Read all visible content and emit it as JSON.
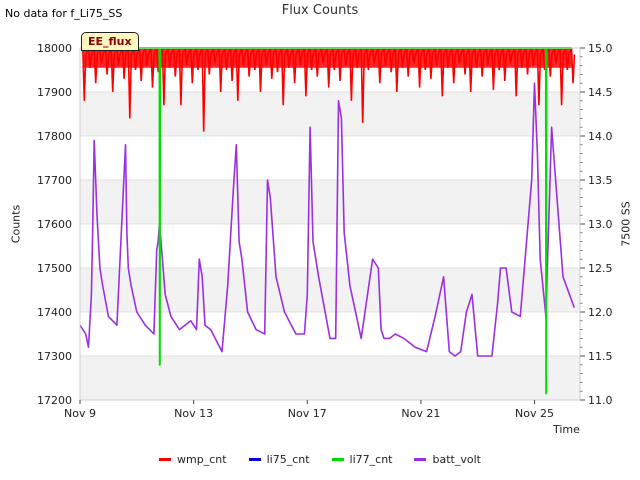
{
  "header": {
    "nodata_text": "No data for f_Li75_SS",
    "title": "Flux Counts",
    "badge": "EE_flux"
  },
  "axes": {
    "ylabel": "Counts",
    "y2label": "7500 SS",
    "xlabel": "Time"
  },
  "colors": {
    "wmp_cnt": "#ff0000",
    "li75_cnt": "#0000cc",
    "li77_cnt": "#00dd00",
    "batt_volt": "#9b30e0"
  },
  "legend": [
    {
      "label": "wmp_cnt",
      "color": "#ff0000"
    },
    {
      "label": "li75_cnt",
      "color": "#0000cc"
    },
    {
      "label": "li77_cnt",
      "color": "#00dd00"
    },
    {
      "label": "batt_volt",
      "color": "#9b30e0"
    }
  ],
  "chart_data": {
    "type": "line",
    "title": "Flux Counts",
    "xlabel": "Time",
    "ylabel": "Counts",
    "y2label": "7500 SS",
    "x_ticks": [
      "Nov 9",
      "Nov 13",
      "Nov 17",
      "Nov 21",
      "Nov 25"
    ],
    "x_tick_days": [
      9,
      13,
      17,
      21,
      25
    ],
    "xlim_days": [
      9,
      26.6
    ],
    "ylim": [
      17200,
      18000
    ],
    "y_ticks": [
      17200,
      17300,
      17400,
      17500,
      17600,
      17700,
      17800,
      17900,
      18000
    ],
    "y2lim": [
      11.0,
      15.0
    ],
    "y2_ticks": [
      11.0,
      11.5,
      12.0,
      12.5,
      13.0,
      13.5,
      14.0,
      14.5,
      15.0
    ],
    "grid": true,
    "legend_position": "bottom",
    "series": [
      {
        "name": "wmp_cnt",
        "axis": "left",
        "x_days": [
          9.1,
          9.3,
          9.5,
          9.7,
          9.9,
          10.1,
          10.3,
          10.5,
          10.7,
          10.9,
          11.1,
          11.3,
          11.5,
          11.7,
          11.9,
          12.1,
          12.3,
          12.5,
          12.7,
          12.9,
          13.1,
          13.3,
          13.5,
          13.7,
          13.9,
          14.1,
          14.3,
          14.5,
          14.7,
          14.9,
          15.1,
          15.3,
          15.5,
          15.7,
          15.9,
          16.1,
          16.3,
          16.5,
          16.7,
          16.9,
          17.1,
          17.3,
          17.5,
          17.7,
          17.9,
          18.1,
          18.3,
          18.5,
          18.7,
          18.9,
          19.1,
          19.3,
          19.5,
          19.7,
          19.9,
          20.1,
          20.3,
          20.5,
          20.7,
          20.9,
          21.1,
          21.3,
          21.5,
          21.7,
          21.9,
          22.1,
          22.3,
          22.5,
          22.7,
          22.9,
          23.1,
          23.3,
          23.5,
          23.7,
          23.9,
          24.1,
          24.3,
          24.5,
          24.7,
          24.9,
          25.1,
          25.3,
          25.5,
          25.7,
          25.9,
          26.1,
          26.3
        ],
        "values": [
          17880,
          17955,
          17920,
          17965,
          17940,
          17900,
          17960,
          17930,
          17840,
          17950,
          17925,
          17960,
          17910,
          17945,
          17870,
          17955,
          17935,
          17870,
          17960,
          17920,
          17950,
          17810,
          17940,
          17965,
          17900,
          17950,
          17925,
          17880,
          17960,
          17935,
          17950,
          17900,
          17960,
          17930,
          17945,
          17870,
          17955,
          17920,
          17960,
          17890,
          17950,
          17935,
          17965,
          17910,
          17950,
          17925,
          17960,
          17880,
          17955,
          17830,
          17950,
          17965,
          17920,
          17960,
          17945,
          17900,
          17955,
          17935,
          17965,
          17910,
          17950,
          17930,
          17960,
          17890,
          17955,
          17920,
          17965,
          17940,
          17900,
          17955,
          17935,
          17960,
          17905,
          17950,
          17925,
          17965,
          17890,
          17955,
          17940,
          17960,
          17870,
          17950,
          17935,
          17965,
          17870,
          17950,
          17920
        ]
      },
      {
        "name": "li75_cnt",
        "axis": "left",
        "x_days": [],
        "values": []
      },
      {
        "name": "li77_cnt",
        "axis": "left",
        "x_days": [
          9.1,
          11.8,
          11.81,
          11.82,
          11.83,
          25.4,
          25.41,
          25.42,
          25.43,
          26.3
        ],
        "values": [
          18000,
          18000,
          17280,
          18000,
          18000,
          18000,
          17215,
          18000,
          18000,
          18000
        ]
      },
      {
        "name": "batt_volt",
        "axis": "right",
        "x_days": [
          9.0,
          9.2,
          9.3,
          9.4,
          9.45,
          9.5,
          9.6,
          9.7,
          9.8,
          10.0,
          10.3,
          10.6,
          10.65,
          10.7,
          10.8,
          11.0,
          11.3,
          11.6,
          11.7,
          11.75,
          11.8,
          11.9,
          12.0,
          12.2,
          12.5,
          12.9,
          13.1,
          13.2,
          13.3,
          13.4,
          13.6,
          14.0,
          14.2,
          14.4,
          14.5,
          14.6,
          14.7,
          14.9,
          15.2,
          15.5,
          15.6,
          15.7,
          15.9,
          16.2,
          16.6,
          16.9,
          17.0,
          17.1,
          17.2,
          17.4,
          17.8,
          18.0,
          18.1,
          18.2,
          18.3,
          18.5,
          18.9,
          19.3,
          19.5,
          19.6,
          19.7,
          19.9,
          20.1,
          20.4,
          20.8,
          21.2,
          21.5,
          21.8,
          22.0,
          22.2,
          22.4,
          22.6,
          22.8,
          23.0,
          23.2,
          23.5,
          23.7,
          23.8,
          24.0,
          24.2,
          24.5,
          24.9,
          25.0,
          25.1,
          25.2,
          25.4,
          25.6,
          26.0,
          26.4
        ],
        "values": [
          11.85,
          11.75,
          11.6,
          12.2,
          13.0,
          13.95,
          13.1,
          12.5,
          12.3,
          11.95,
          11.85,
          13.9,
          12.9,
          12.5,
          12.3,
          12.0,
          11.85,
          11.75,
          12.7,
          12.8,
          13.0,
          12.6,
          12.2,
          11.95,
          11.8,
          11.9,
          11.8,
          12.6,
          12.4,
          11.85,
          11.8,
          11.55,
          12.3,
          13.4,
          13.9,
          12.8,
          12.6,
          12.0,
          11.8,
          11.75,
          13.5,
          13.3,
          12.4,
          12.0,
          11.75,
          11.75,
          12.2,
          14.1,
          12.8,
          12.4,
          11.7,
          11.7,
          14.4,
          14.2,
          12.9,
          12.3,
          11.7,
          12.6,
          12.5,
          11.8,
          11.7,
          11.7,
          11.75,
          11.7,
          11.6,
          11.55,
          11.95,
          12.4,
          11.55,
          11.5,
          11.55,
          12.0,
          12.2,
          11.5,
          11.5,
          11.5,
          12.1,
          12.5,
          12.5,
          12.0,
          11.95,
          13.5,
          14.6,
          13.8,
          12.6,
          11.95,
          14.1,
          12.4,
          12.05
        ]
      }
    ]
  }
}
